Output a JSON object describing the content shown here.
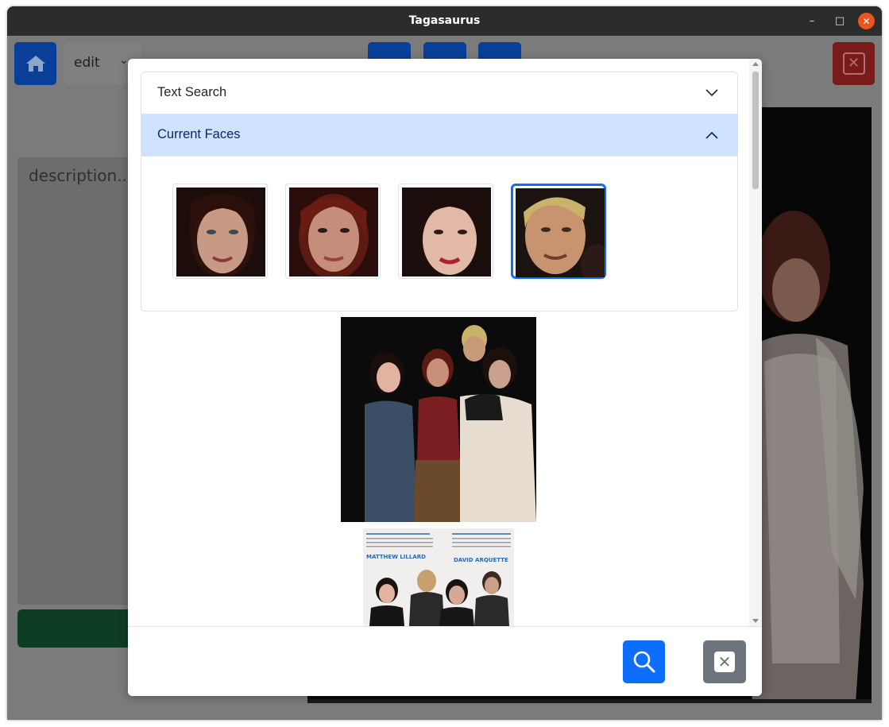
{
  "window": {
    "title": "Tagasaurus",
    "controls": {
      "minimize": "–",
      "maximize": "□",
      "close": "✕"
    }
  },
  "app": {
    "home_icon": "home-icon",
    "mode_select": {
      "value": "edit",
      "chevron": "⌄"
    },
    "description_placeholder": "description...",
    "delete_icon": "close-icon",
    "delete_label": "✕"
  },
  "modal": {
    "accordion": [
      {
        "label": "Text Search",
        "expanded": false
      },
      {
        "label": "Current Faces",
        "expanded": true
      }
    ],
    "faces": [
      {
        "name": "face-1",
        "selected": false
      },
      {
        "name": "face-2",
        "selected": false
      },
      {
        "name": "face-3",
        "selected": false
      },
      {
        "name": "face-4",
        "selected": true
      }
    ],
    "results": [
      {
        "name": "group-photo"
      },
      {
        "name": "magazine-scan",
        "captions": [
          "MATTHEW LILLARD",
          "DAVID ARQUETTE"
        ]
      }
    ],
    "footer": {
      "search_icon": "search-icon",
      "close_label": "✕"
    }
  },
  "colors": {
    "primary": "#0d6efd",
    "secondary": "#6c757d",
    "accordion_active_bg": "#cfe2ff",
    "accordion_active_text": "#052c65",
    "window_close": "#e95420"
  }
}
